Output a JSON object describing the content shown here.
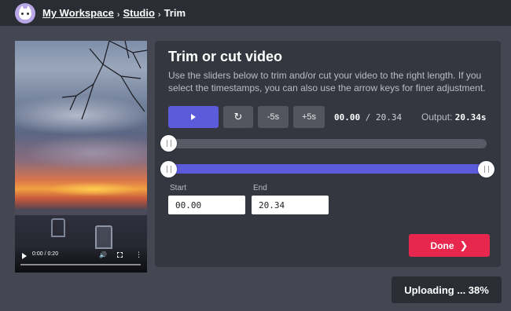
{
  "header": {
    "breadcrumbs": [
      "My Workspace",
      "Studio"
    ],
    "current": "Trim",
    "separator": "›"
  },
  "video": {
    "time_display": "0:00 / 0:20",
    "icons": [
      "play-icon",
      "volume-icon",
      "fullscreen-icon",
      "more-options-icon"
    ]
  },
  "panel": {
    "title": "Trim or cut video",
    "description": "Use the sliders below to trim and/or cut your video to the right length. If you select the timestamps, you can also use the arrow keys for finer adjustment.",
    "controls": {
      "minus5": "-5s",
      "plus5": "+5s",
      "reset_icon": "↻"
    },
    "time": {
      "current": "00.00",
      "sep": " / ",
      "total": "20.34"
    },
    "output": {
      "label": "Output: ",
      "value": "20.34s"
    },
    "sliders": {
      "playhead_fraction": 0,
      "trim_start_fraction": 0,
      "trim_end_fraction": 1
    },
    "start": {
      "label": "Start",
      "value": "00.00"
    },
    "end": {
      "label": "End",
      "value": "20.34"
    },
    "done_label": "Done",
    "done_chevron": "❯"
  },
  "status": {
    "uploading": "Uploading ... 38%"
  },
  "colors": {
    "accent": "#5b5bdb",
    "done": "#e8274f",
    "background": "#444752",
    "panel": "#343640"
  }
}
